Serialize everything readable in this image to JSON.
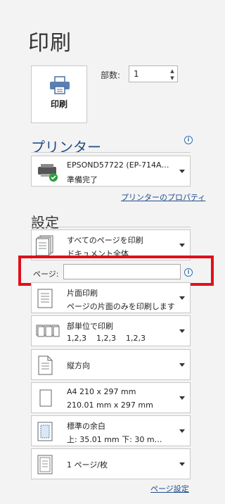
{
  "title": "印刷",
  "print_button": {
    "label": "印刷"
  },
  "copies": {
    "label": "部数:",
    "value": "1"
  },
  "printer_section": {
    "heading": "プリンター",
    "printer_name": "EPSOND57722 (EP-714A…",
    "printer_status": "準備完了",
    "properties_link": "プリンターのプロパティ"
  },
  "settings_section": {
    "heading": "設定",
    "print_range": {
      "line1": "すべてのページを印刷",
      "line2": "ドキュメント全体"
    },
    "pages": {
      "label": "ページ:",
      "value": ""
    },
    "sides": {
      "line1": "片面印刷",
      "line2": "ページの片面のみを印刷します"
    },
    "collation": {
      "line1": "部単位で印刷",
      "line2": "1,2,3    1,2,3    1,2,3"
    },
    "orientation": {
      "line1": "縦方向"
    },
    "paper_size": {
      "line1": "A4 210 x 297 mm",
      "line2": "210.01 mm x 297 mm"
    },
    "margins": {
      "line1": "標準の余白",
      "line2": "上: 35.01 mm 下: 30 m…"
    },
    "pages_per_sheet": {
      "line1": "1 ページ/枚"
    },
    "page_setup_link": "ページ設定"
  },
  "colors": {
    "accent": "#1f4e8c",
    "highlight": "#e0101a",
    "ok_green": "#2e9e3e"
  }
}
